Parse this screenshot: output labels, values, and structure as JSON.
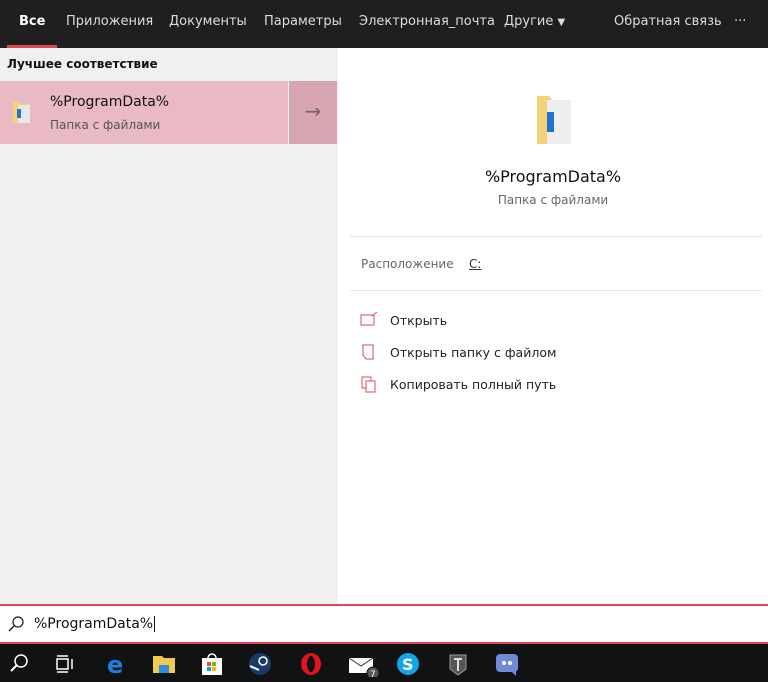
{
  "tabs": [
    {
      "label": "Все",
      "active": true
    },
    {
      "label": "Приложения"
    },
    {
      "label": "Документы"
    },
    {
      "label": "Параметры"
    },
    {
      "label": "Электронная_почта"
    },
    {
      "label": "Другие"
    }
  ],
  "feedback": "Обратная связь",
  "more": "···",
  "left": {
    "section": "Лучшее соответствие",
    "best": {
      "title": "%ProgramData%",
      "subtitle": "Папка с файлами"
    }
  },
  "detail": {
    "title": "%ProgramData%",
    "subtitle": "Папка с файлами",
    "location_label": "Расположение",
    "location_value": "C:",
    "actions": [
      {
        "label": "Открыть",
        "icon": "open-icon"
      },
      {
        "label": "Открыть папку с файлом",
        "icon": "open-folder-icon"
      },
      {
        "label": "Копировать полный путь",
        "icon": "copy-icon"
      }
    ]
  },
  "search": {
    "value": "%ProgramData%"
  },
  "taskbar": {
    "mail_badge": "7"
  },
  "colors": {
    "accent": "#e0485a",
    "highlight": "#e9bac3"
  }
}
